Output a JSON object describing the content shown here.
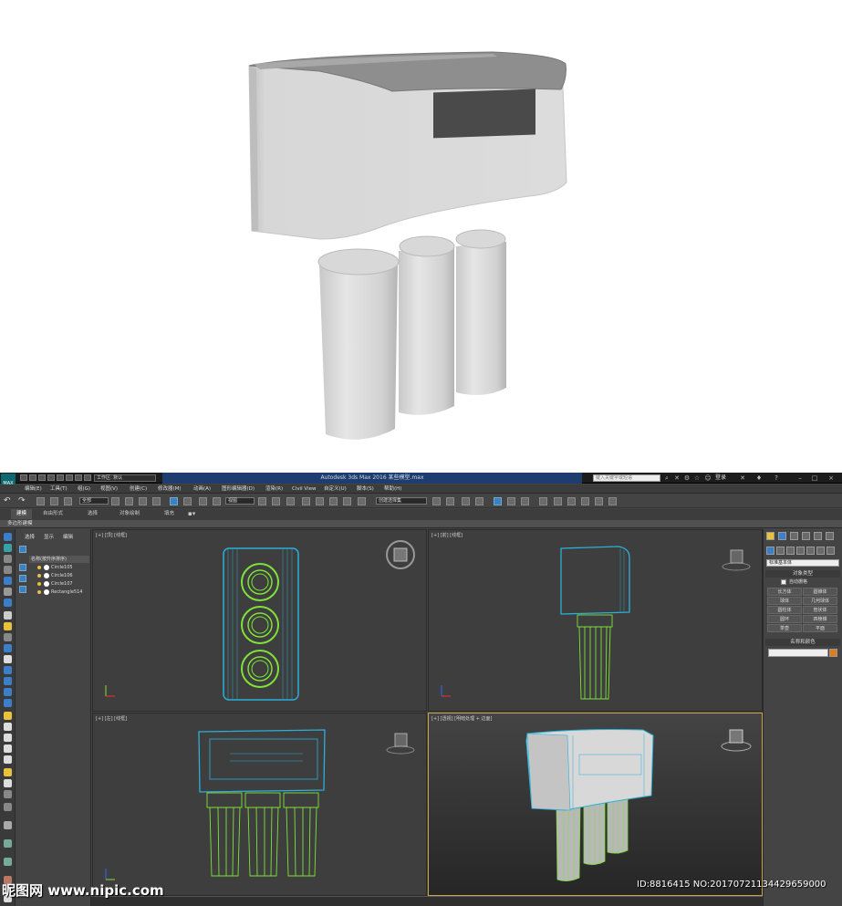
{
  "titlebar": {
    "logo_text": "MAX",
    "workspace": "工作区: 默认",
    "title": "Autodesk 3ds Max 2016      某些模型.max",
    "search_placeholder": "键入关键字或短语",
    "login": "登录"
  },
  "menubar": [
    "编辑(E)",
    "工具(T)",
    "组(G)",
    "视图(V)",
    "创建(C)",
    "修改器(M)",
    "动画(A)",
    "图形编辑器(D)",
    "渲染(R)",
    "Civil View",
    "自定义(U)",
    "脚本(S)",
    "帮助(H)"
  ],
  "toolbar": {
    "filter": "全部",
    "coord": "视图",
    "selection_set": "创建选择集"
  },
  "ribbon": {
    "tabs": [
      "建模",
      "自由形式",
      "选择",
      "对象绘制",
      "填充"
    ],
    "subtitle": "多边形建模"
  },
  "scene_explorer": {
    "tabs": [
      "选择",
      "显示",
      "编辑"
    ],
    "header": "名称(按升序排序)",
    "items": [
      "Circle105",
      "Circle106",
      "Circle107",
      "Rectangle514"
    ]
  },
  "viewports": [
    {
      "label": "[+] [顶] [线框]"
    },
    {
      "label": "[+] [前] [线框]"
    },
    {
      "label": "[+] [左] [线框]"
    },
    {
      "label": "[+] [透视] [明暗处理 + 边面]"
    }
  ],
  "command_panel": {
    "dropdown": "标准基本体",
    "section_object_type": "对象类型",
    "autogrid": "自动栅格",
    "buttons": [
      "长方体",
      "圆锥体",
      "球体",
      "几何球体",
      "圆柱体",
      "管状体",
      "圆环",
      "四棱锥",
      "茶壶",
      "平面"
    ],
    "section_name_color": "名称和颜色",
    "color": "#e07c1e"
  },
  "watermark": {
    "site": "昵图网 www.nipic.com",
    "id": "ID:8816415 NO:20170721134429659000"
  },
  "colors": {
    "wire_green": "#7ee23a",
    "wire_cyan": "#2ab0d8",
    "accent_blue": "#3a7fc8"
  }
}
